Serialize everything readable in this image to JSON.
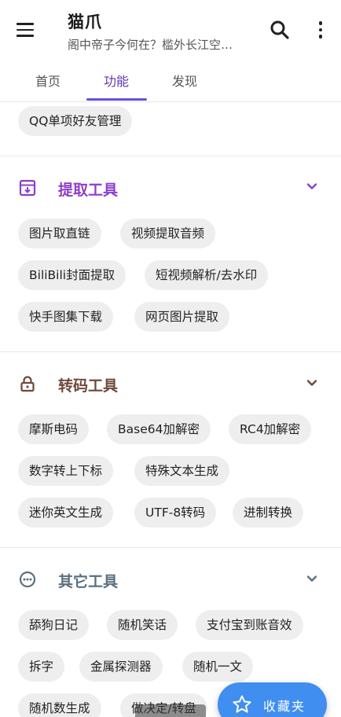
{
  "app": {
    "title": "猫爪",
    "subtitle": "阁中帝子今何在？槛外长江空…",
    "accent_color": "#6a4fd8"
  },
  "tabs": [
    {
      "label": "首页",
      "active": false
    },
    {
      "label": "功能",
      "active": true
    },
    {
      "label": "发现",
      "active": false
    }
  ],
  "top_chip": {
    "label": "QQ单项好友管理"
  },
  "sections": [
    {
      "title": "提取工具",
      "icon": "archive-box-icon",
      "color": "#8e3fc9",
      "chips": [
        "图片取直链",
        "视频提取音频",
        "BiliBili封面提取",
        "短视频解析/去水印",
        "快手图集下载",
        "网页图片提取"
      ]
    },
    {
      "title": "转码工具",
      "icon": "lock-icon",
      "color": "#6d4a3a",
      "chips": [
        "摩斯电码",
        "Base64加解密",
        "RC4加解密",
        "数字转上下标",
        "特殊文本生成",
        "迷你英文生成",
        "UTF-8转码",
        "进制转换"
      ]
    },
    {
      "title": "其它工具",
      "icon": "more-circle-icon",
      "color": "#5a7080",
      "chips": [
        "舔狗日记",
        "随机笑话",
        "支付宝到账音效",
        "拆字",
        "金属探测器",
        "随机一文",
        "随机数生成",
        "做决定/转盘"
      ]
    }
  ],
  "fab": {
    "label": "收藏夹",
    "color": "#3f8ef0"
  }
}
